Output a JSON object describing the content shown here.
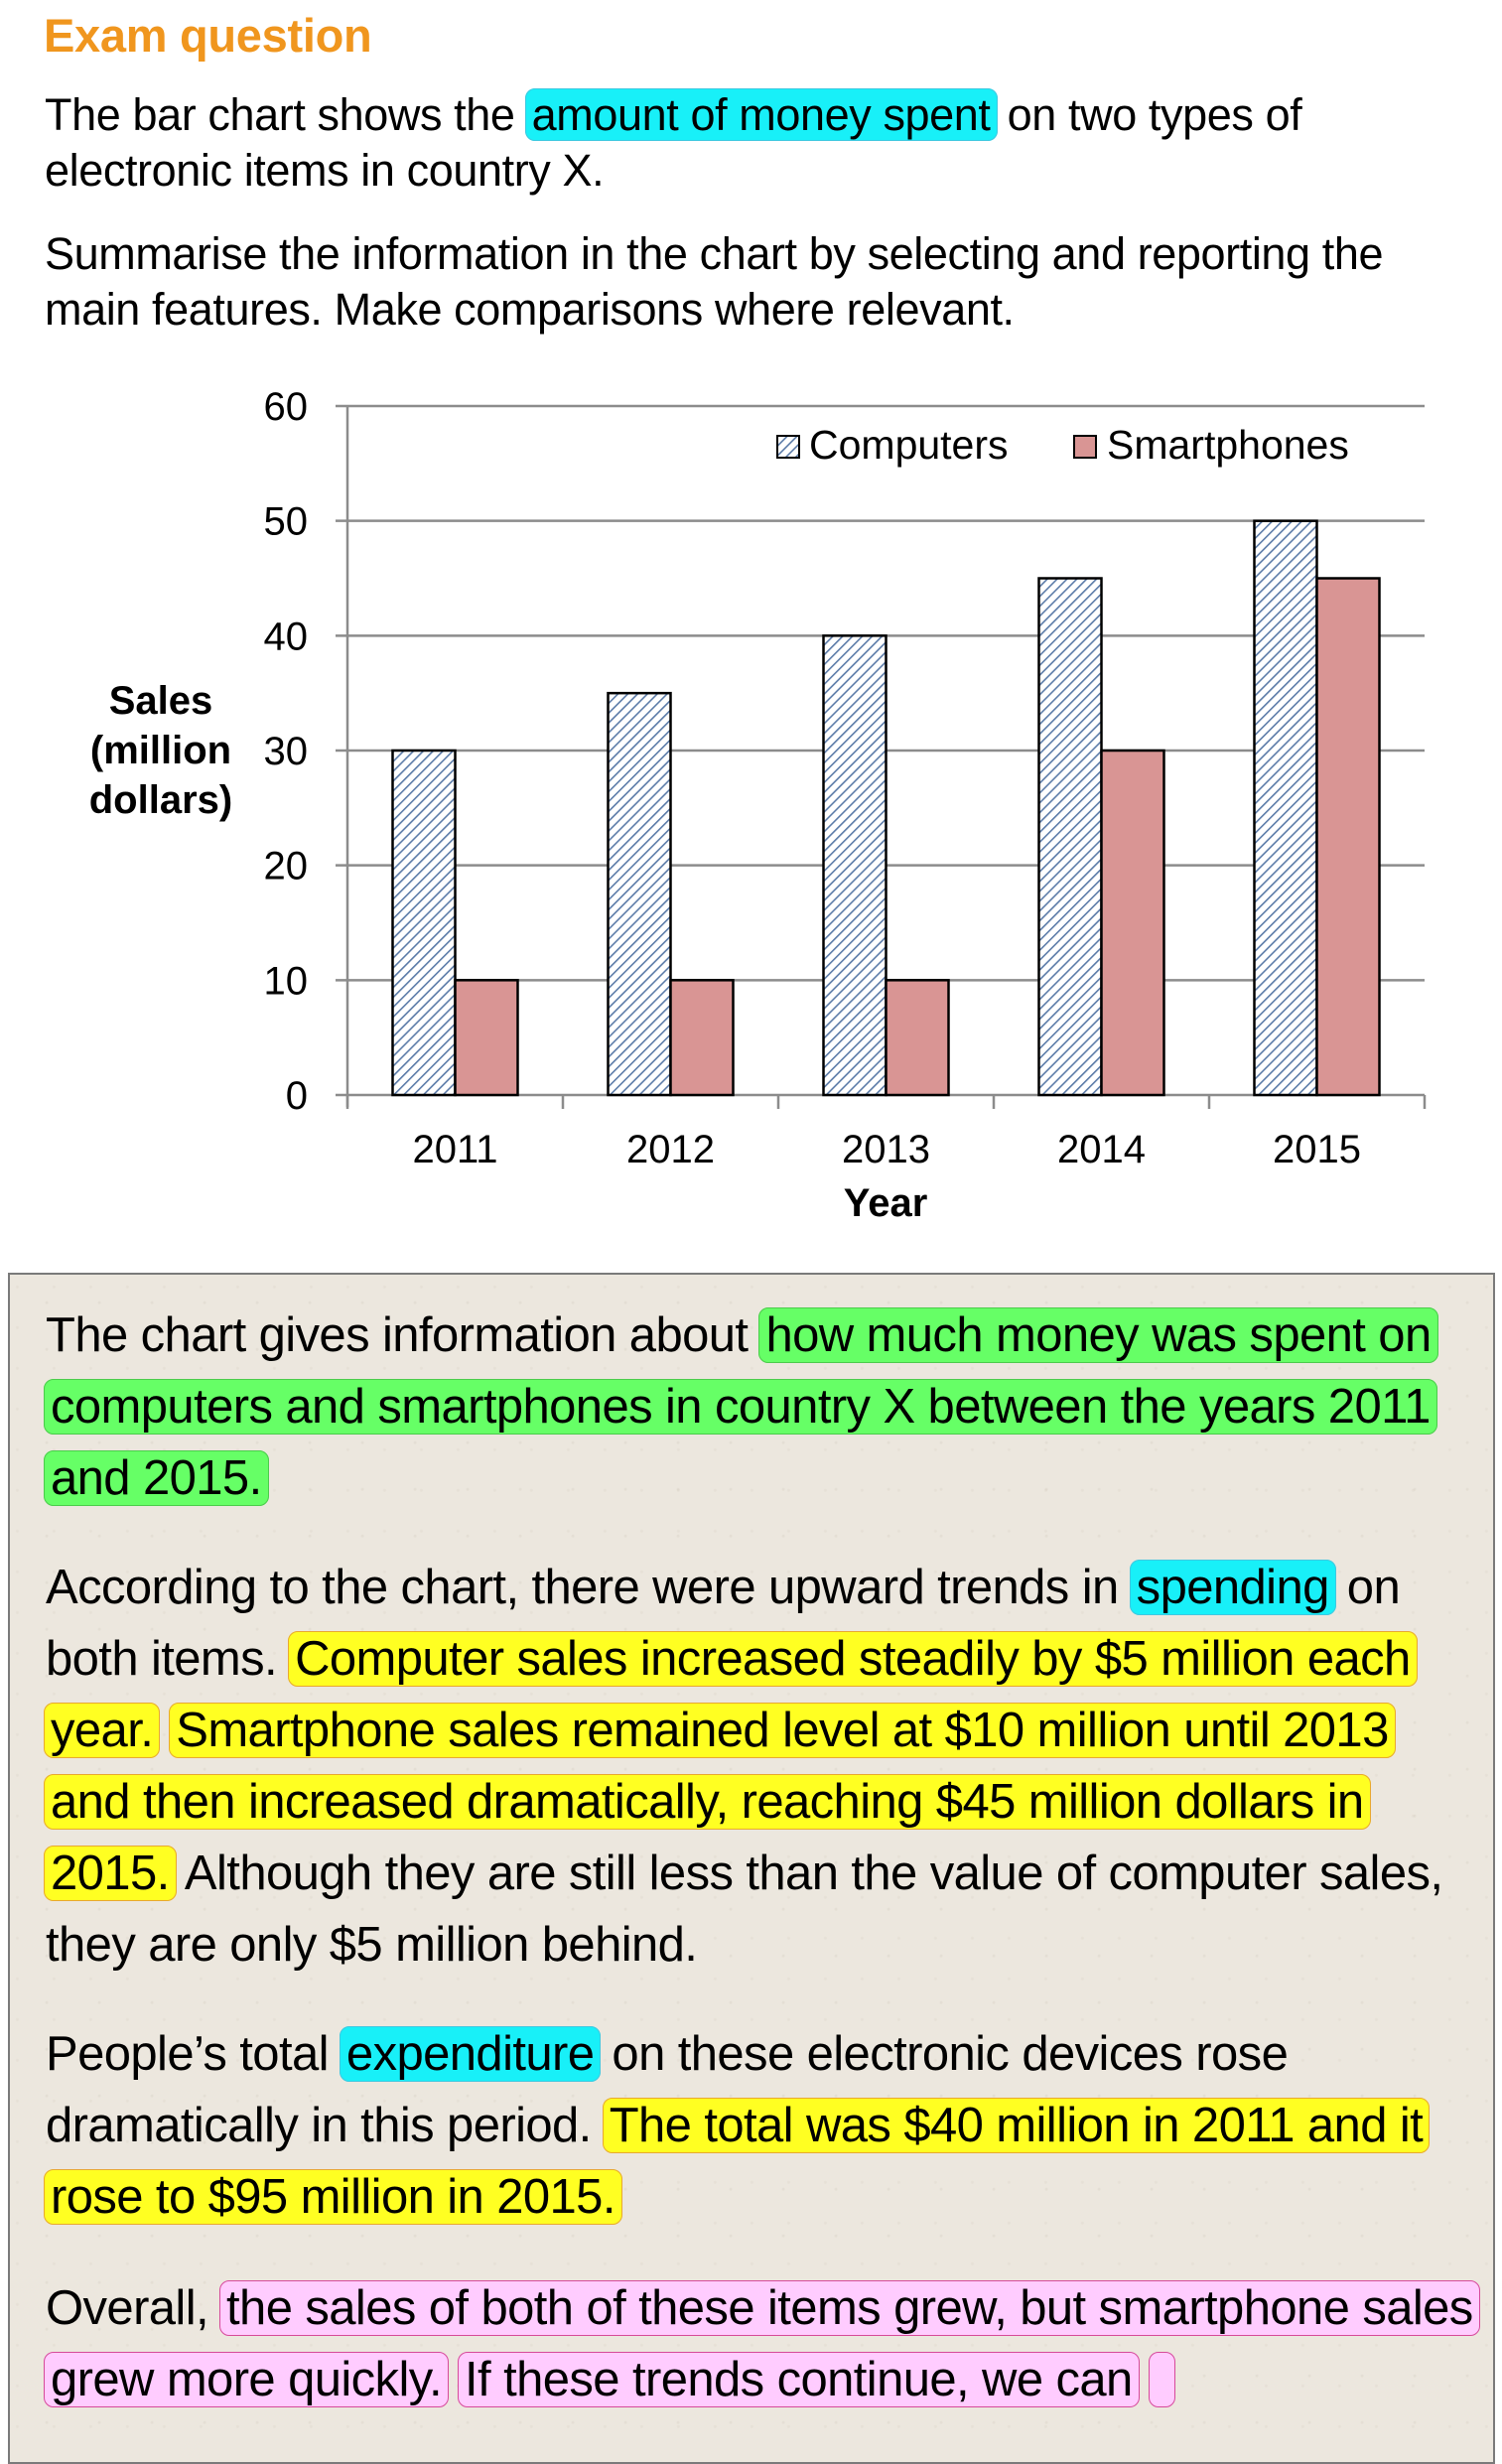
{
  "header": {
    "title": "Exam question"
  },
  "question": {
    "p1": [
      {
        "text": "The bar chart shows the ",
        "highlight": null
      },
      {
        "text": "amount of money spent",
        "highlight": "cyan"
      },
      {
        "text": " on two types of electronic items in country X.",
        "highlight": null
      }
    ],
    "p2": "Summarise the information in the chart by selecting and reporting the main features. Make comparisons where relevant."
  },
  "chart_data": {
    "type": "bar",
    "title": "",
    "categories": [
      "2011",
      "2012",
      "2013",
      "2014",
      "2015"
    ],
    "series": [
      {
        "name": "Computers",
        "values": [
          30,
          35,
          40,
          45,
          50
        ],
        "pattern": "diagonal-hatch",
        "color": "#5B7BA8"
      },
      {
        "name": "Smartphones",
        "values": [
          10,
          10,
          10,
          30,
          45
        ],
        "pattern": "solid",
        "color": "#D99594"
      }
    ],
    "xlabel": "Year",
    "ylabel": "Sales (million dollars)",
    "ylabel_lines": [
      "Sales",
      "(million",
      "dollars)"
    ],
    "ylim": [
      0,
      60
    ],
    "yticks": [
      0,
      10,
      20,
      30,
      40,
      50,
      60
    ],
    "grid": true,
    "legend": "top-right"
  },
  "answer": {
    "paragraphs": [
      [
        {
          "text": "The chart gives information about ",
          "highlight": null
        },
        {
          "text": "how much money was spent on computers and smartphones in country X between the years 2011 and 2015.",
          "highlight": "green"
        }
      ],
      [
        {
          "text": "According to the chart, there were upward trends in ",
          "highlight": null
        },
        {
          "text": "spending",
          "highlight": "cyan"
        },
        {
          "text": " on both items. ",
          "highlight": null
        },
        {
          "text": "Computer sales increased steadily by $5 million each year.",
          "highlight": "yellow"
        },
        {
          "text": " ",
          "highlight": null
        },
        {
          "text": "Smartphone sales remained level at $10 million until 2013 and then increased dramatically, reaching $45 million dollars in 2015.",
          "highlight": "yellow"
        },
        {
          "text": " Although they are still less than the value of computer sales, they are only $5 million behind.",
          "highlight": null
        }
      ],
      [
        {
          "text": "People’s total ",
          "highlight": null
        },
        {
          "text": "expenditure",
          "highlight": "cyan"
        },
        {
          "text": " on these electronic devices rose dramatically in this period. ",
          "highlight": null
        },
        {
          "text": "The total was $40 million in 2011 and it rose to $95 million in 2015.",
          "highlight": "yellow"
        }
      ],
      [
        {
          "text": "Overall, ",
          "highlight": null
        },
        {
          "text": "the sales of both of these items grew, but smartphone sales grew more quickly.",
          "highlight": "pink"
        },
        {
          "text": " ",
          "highlight": null
        },
        {
          "text": "If these trends continue, we can",
          "highlight": "pink"
        },
        {
          "text": " ",
          "highlight": null
        },
        {
          "text": " ",
          "highlight": "pink"
        }
      ]
    ]
  },
  "colors": {
    "title": "#F0961E",
    "highlight_cyan": "#18F0F8",
    "highlight_green": "#66FF66",
    "highlight_yellow": "#FFFF22",
    "highlight_pink": "#FFCCFF",
    "computers": "#5B7BA8",
    "smartphones": "#D99594",
    "panel_bg": "#ECE7DE"
  }
}
